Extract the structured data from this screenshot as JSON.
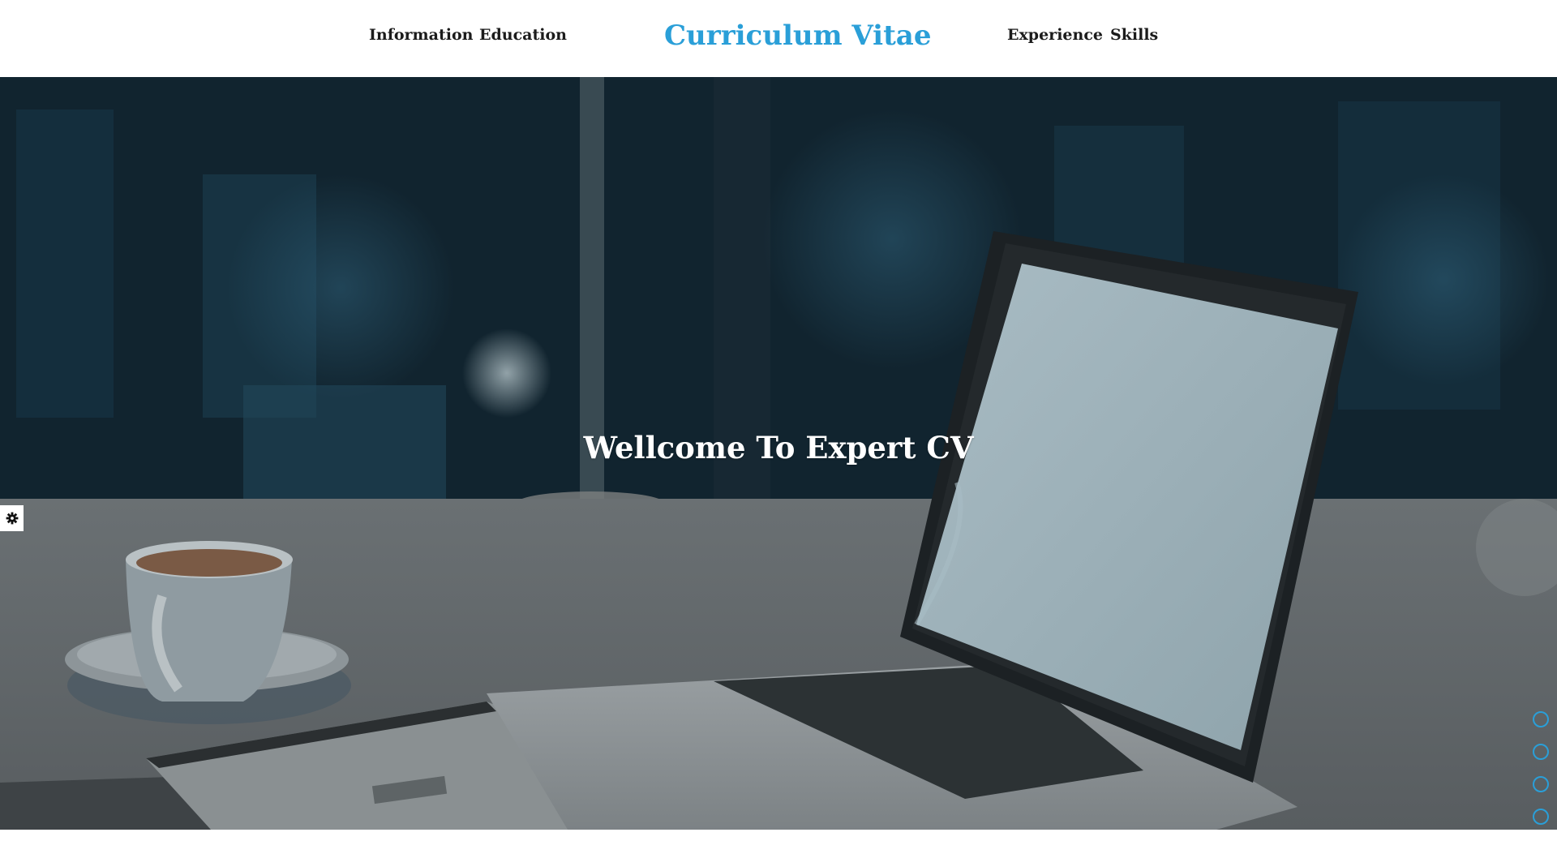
{
  "nav": {
    "left_links": [
      "Information",
      "Education"
    ],
    "right_links": [
      "Experience",
      "Skills"
    ],
    "brand": "Curriculum Vitae"
  },
  "hero": {
    "title": "Wellcome To Expert CV"
  },
  "settings": {
    "icon": "gear-icon"
  },
  "dots_nav": {
    "count": 4
  },
  "colors": {
    "accent": "#2a9fd8",
    "nav_text": "#1b1b1b",
    "hero_title": "#ffffff"
  }
}
